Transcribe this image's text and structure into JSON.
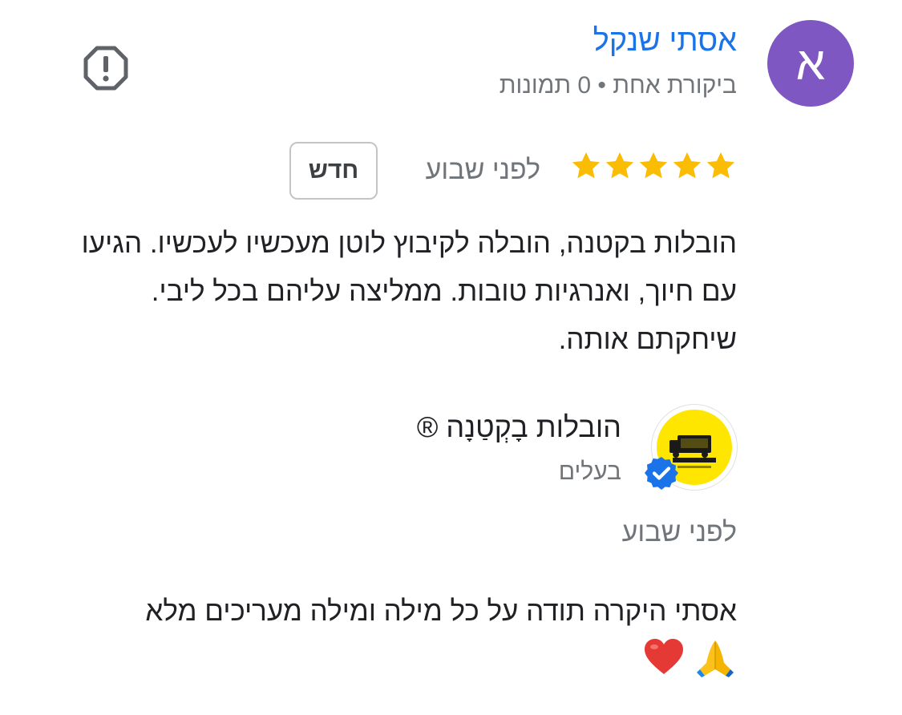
{
  "reviewer": {
    "initial": "א",
    "name": "אסתי שנקל",
    "meta": "ביקורת אחת • 0 תמונות",
    "avatar_color": "#7e57c2"
  },
  "review": {
    "rating": 5,
    "max_rating": 5,
    "time": "לפני שבוע",
    "badge": "חדש",
    "text": "הובלות בקטנה, הובלה לקיבוץ לוטן מעכשיו לעכשיו. הגיעו עם חיוך, ואנרגיות טובות. ממליצה עליהם בכל ליבי. שיחקתם אותה."
  },
  "owner_reply": {
    "name": "הובלות בָקְטַנָה ®",
    "role": "בעלים",
    "time": "לפני שבוע",
    "text": "אסתי היקרה תודה על כל מילה ומילה מעריכים מלא",
    "emojis": [
      "folded-hands-icon",
      "red-heart-icon"
    ]
  },
  "colors": {
    "link_blue": "#1a73e8",
    "star_gold": "#fbbc04",
    "secondary_text": "#70757a",
    "verified_blue": "#1a73e8"
  },
  "icons": {
    "report": "report-octagon-icon",
    "star": "star-icon",
    "verified": "verified-badge-icon"
  }
}
